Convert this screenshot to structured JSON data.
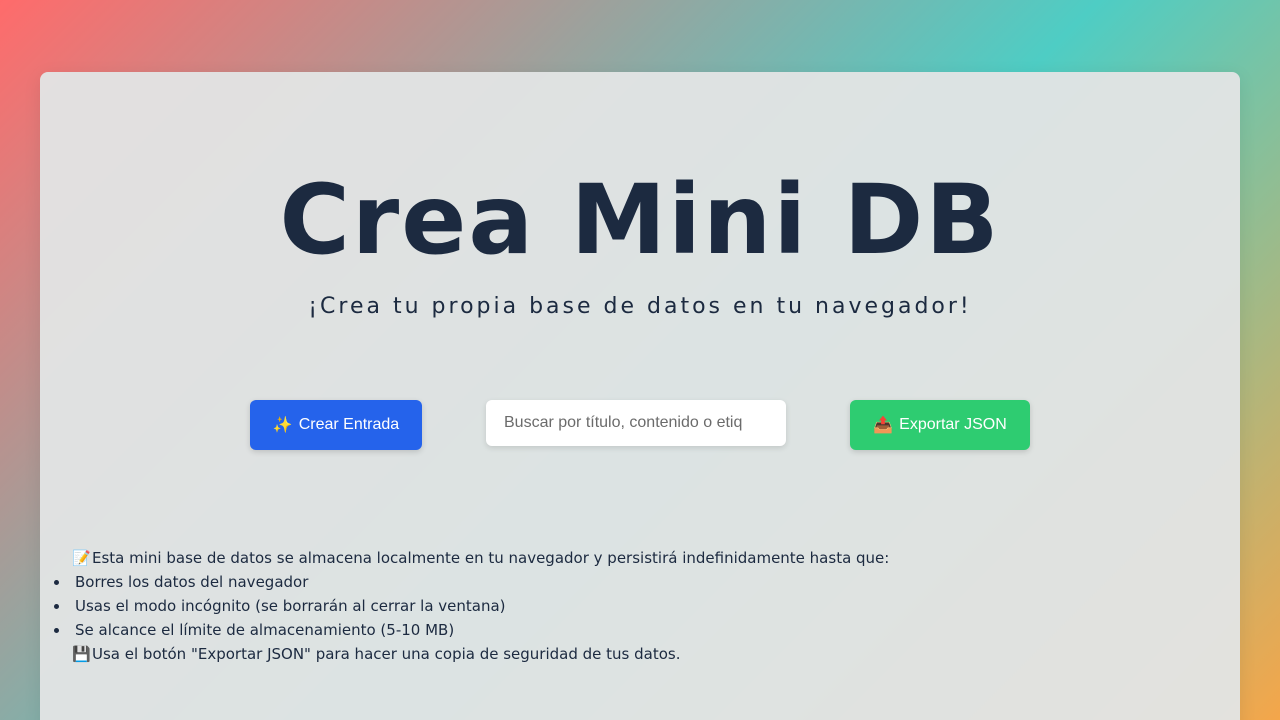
{
  "header": {
    "title": "Crea Mini DB",
    "subtitle": "¡Crea tu propia base de datos en tu navegador!"
  },
  "actions": {
    "create": {
      "icon": "sparkles-icon",
      "glyph": "✨",
      "label": "Crear Entrada"
    },
    "search": {
      "placeholder": "Buscar por título, contenido o etiq",
      "value": ""
    },
    "export": {
      "icon": "outbox-tray-icon",
      "glyph": "📤",
      "label": "Exportar JSON"
    }
  },
  "info": {
    "intro_icon": "memo-icon",
    "intro_glyph": "📝",
    "intro": "Esta mini base de datos se almacena localmente en tu navegador y persistirá indefinidamente hasta que:",
    "items": [
      "Borres los datos del navegador",
      "Usas el modo incógnito (se borrarán al cerrar la ventana)",
      "Se alcance el límite de almacenamiento (5-10 MB)"
    ],
    "footer_icon": "floppy-disk-icon",
    "footer_glyph": "💾",
    "footer": "Usa el botón \"Exportar JSON\" para hacer una copia de seguridad de tus datos."
  },
  "colors": {
    "primary_button": "#2563eb",
    "export_button": "#2ecc71",
    "text": "#1c2a40"
  }
}
